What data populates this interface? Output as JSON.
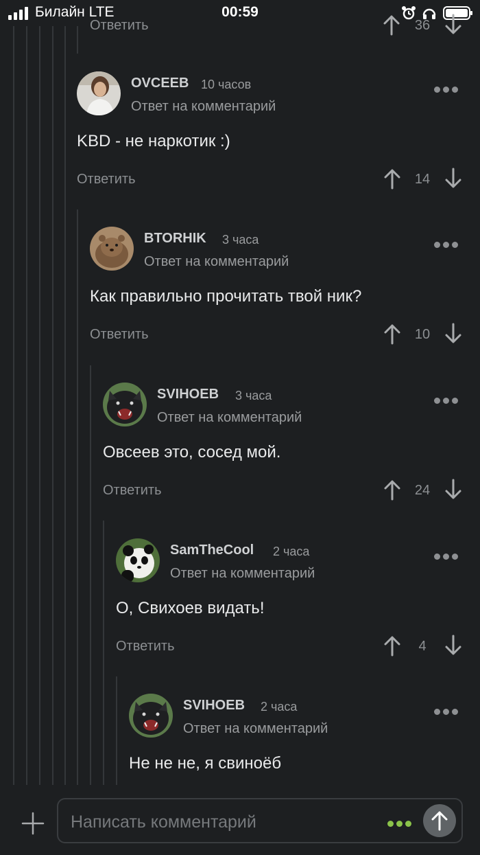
{
  "status_bar": {
    "carrier": "Билайн  LTE",
    "time": "00:59"
  },
  "partial_top": {
    "reply_label": "Ответить",
    "vote_count": "36"
  },
  "comments": [
    {
      "author": "OVCEEB",
      "time": "10 часов",
      "reply_to": "Ответ на комментарий",
      "text": "KBD - не наркотик :)",
      "reply_label": "Ответить",
      "votes": "14",
      "avatar": "man-portrait"
    },
    {
      "author": "BTORHIK",
      "time": "3 часа",
      "reply_to": "Ответ на комментарий",
      "text": "Как правильно прочитать твой ник?",
      "reply_label": "Ответить",
      "votes": "10",
      "avatar": "quokka"
    },
    {
      "author": "SVIHOEB",
      "time": "3 часа",
      "reply_to": "Ответ на комментарий",
      "text": "Овсеев это, сосед мой.",
      "reply_label": "Ответить",
      "votes": "24",
      "avatar": "black-pig"
    },
    {
      "author": "SamTheCool",
      "time": "2 часа",
      "reply_to": "Ответ на комментарий",
      "text": "О, Свихоев видать!",
      "reply_label": "Ответить",
      "votes": "4",
      "avatar": "panda"
    },
    {
      "author": "SVIHOEB",
      "time": "2 часа",
      "reply_to": "Ответ на комментарий",
      "text": "Не не не, я свиноёб",
      "avatar": "black-pig"
    }
  ],
  "composer": {
    "placeholder": "Написать комментарий"
  },
  "colors": {
    "background": "#1d1f21",
    "accent_dots": "#8bc34a",
    "send_button": "#5f6366"
  }
}
